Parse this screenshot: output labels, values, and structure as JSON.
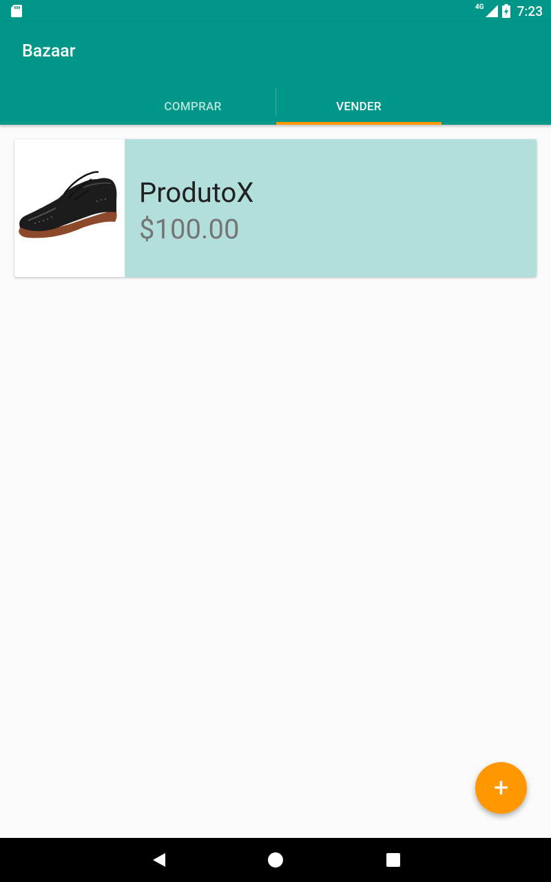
{
  "status_bar": {
    "network_label": "4G",
    "time": "7:23"
  },
  "app_bar": {
    "title": "Bazaar"
  },
  "tabs": [
    {
      "label": "COMPRAR",
      "selected": false
    },
    {
      "label": "VENDER",
      "selected": true
    }
  ],
  "products": [
    {
      "name": "ProdutoX",
      "price": "$100.00",
      "image": "shoe-image"
    }
  ],
  "fab": {
    "icon": "add-icon",
    "label": "+"
  },
  "colors": {
    "primary": "#009688",
    "accent": "#ff9800",
    "card_background": "#b2dfdb"
  }
}
